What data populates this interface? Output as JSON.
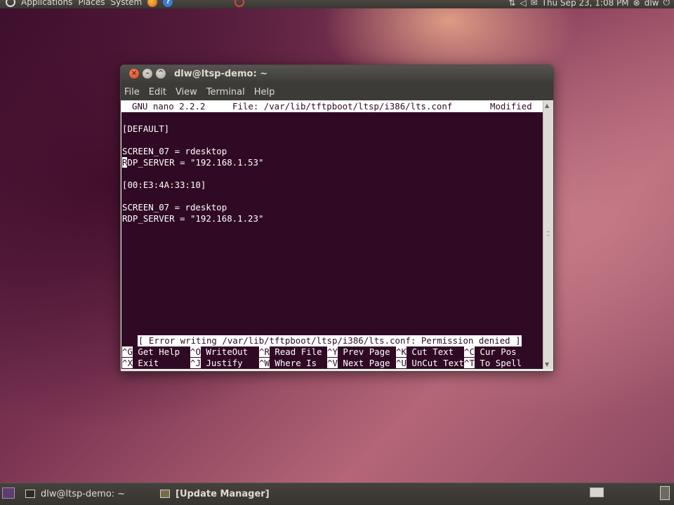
{
  "top_panel": {
    "menus": [
      "Applications",
      "Places",
      "System"
    ],
    "clock": "Thu Sep 23,  1:08 PM",
    "user": "dlw"
  },
  "window": {
    "title": "dlw@ltsp-demo: ~",
    "menu": [
      "File",
      "Edit",
      "View",
      "Terminal",
      "Help"
    ]
  },
  "nano": {
    "header": {
      "version": "GNU nano 2.2.2",
      "file": "File: /var/lib/tftpboot/ltsp/i386/lts.conf",
      "state": "Modified"
    },
    "lines": [
      "",
      "[DEFAULT]",
      "",
      "SCREEN_07 = rdesktop",
      "RDP_SERVER = \"192.168.1.53\"",
      "",
      "[00:E3:4A:33:10]",
      "",
      "SCREEN_07 = rdesktop",
      "RDP_SERVER = \"192.168.1.23\""
    ],
    "status": "[ Error writing /var/lib/tftpboot/ltsp/i386/lts.conf: Permission denied ]",
    "shortcuts_row1": [
      {
        "key": "^G",
        "label": "Get Help"
      },
      {
        "key": "^O",
        "label": "WriteOut"
      },
      {
        "key": "^R",
        "label": "Read File"
      },
      {
        "key": "^Y",
        "label": "Prev Page"
      },
      {
        "key": "^K",
        "label": "Cut Text"
      },
      {
        "key": "^C",
        "label": "Cur Pos"
      }
    ],
    "shortcuts_row2": [
      {
        "key": "^X",
        "label": "Exit"
      },
      {
        "key": "^J",
        "label": "Justify"
      },
      {
        "key": "^W",
        "label": "Where Is"
      },
      {
        "key": "^V",
        "label": "Next Page"
      },
      {
        "key": "^U",
        "label": "UnCut Text"
      },
      {
        "key": "^T",
        "label": "To Spell"
      }
    ]
  },
  "bottom_panel": {
    "tasks": [
      "dlw@ltsp-demo: ~",
      "[Update Manager]"
    ]
  }
}
